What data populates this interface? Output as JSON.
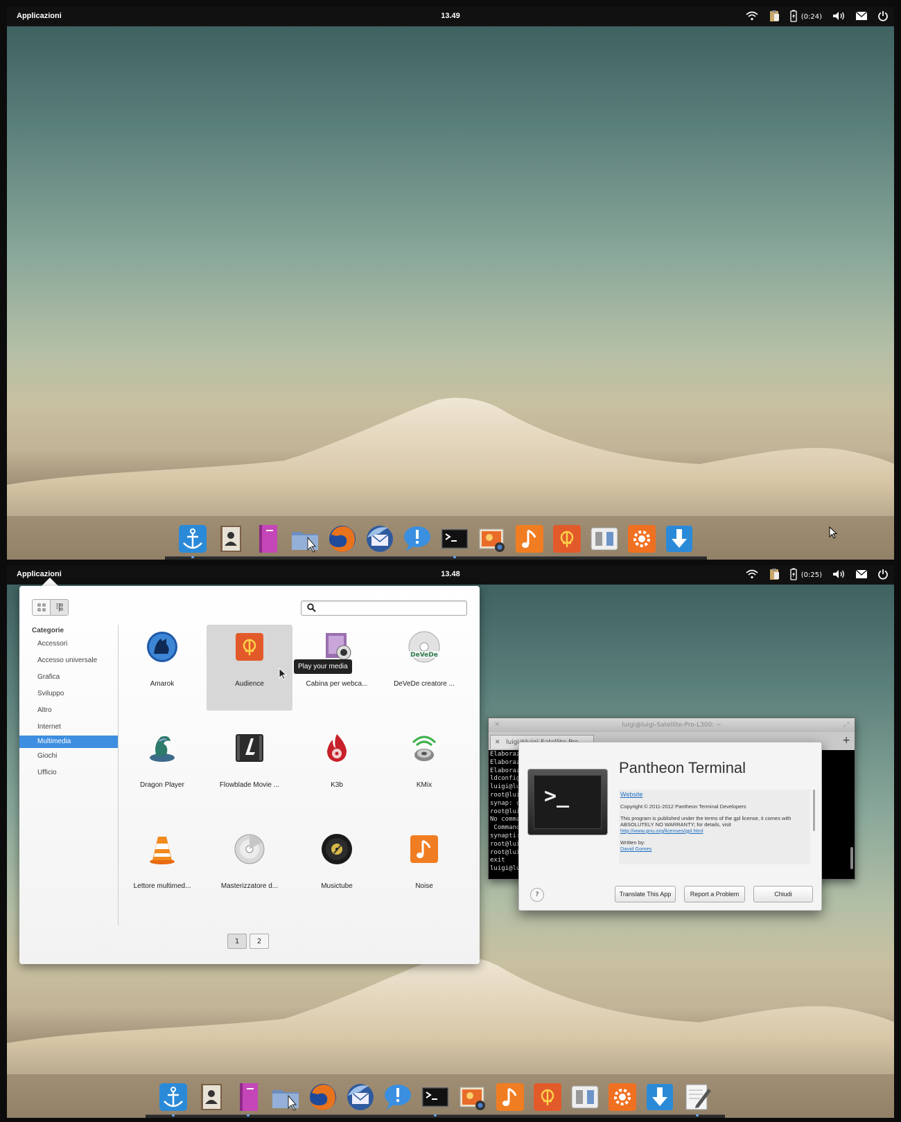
{
  "screen1": {
    "panel": {
      "apps_label": "Applicazioni",
      "clock": "13.49",
      "battery_time": "(0:24)"
    }
  },
  "screen2": {
    "panel": {
      "apps_label": "Applicazioni",
      "clock": "13.48",
      "battery_time": "(0:25)"
    },
    "launcher": {
      "categories_header": "Categorie",
      "categories": [
        "Accessori",
        "Accesso universale",
        "Grafica",
        "Sviluppo",
        "Altro",
        "Internet",
        "Multimedia",
        "Giochi",
        "Ufficio"
      ],
      "selected_category": "Multimedia",
      "apps": [
        "Amarok",
        "Audience",
        "Cabina per webca...",
        "DeVeDe creatore ...",
        "Dragon Player",
        "Flowblade Movie ...",
        "K3b",
        "KMix",
        "Lettore multimed...",
        "Masterizzatore d...",
        "Musictube",
        "Noise"
      ],
      "tooltip": "Play your media",
      "pages": [
        "1",
        "2"
      ]
    },
    "terminal": {
      "title": "luigi@luigi-Satellite-Pro-L300: ~",
      "tab_label": "luigi@luigi-Satellite-Pro-L300: ~",
      "lines": [
        "Elaborazi",
        "Elaborazi",
        "Elaborazi",
        "ldconfig",
        "luigi@lui",
        "root@luigi",
        "synap: co",
        "root@luigi",
        "No comman",
        " Command",
        "synapti:",
        "root@luigi",
        "root@luigi",
        "exit",
        "luigi@lui"
      ]
    },
    "about": {
      "title": "Pantheon Terminal",
      "website": "Website",
      "copyright": "Copyright © 2011-2012 Pantheon Terminal Developers",
      "license_text": "This program is published under the terms of the gpl license, it comes with ABSOLUTELY NO WARRANTY; for details, visit",
      "license_link": "http://www.gnu.org/licenses/gpl.html",
      "written_by": "Written by:",
      "author": "David Gomes",
      "help": "?",
      "translate_button": "Translate This App",
      "report_button": "Report a Problem",
      "close_button": "Chiudi"
    }
  },
  "dock1_icons": [
    "anchor-icon",
    "contacts-icon",
    "notebook-icon",
    "file-manager-icon",
    "firefox-icon",
    "thunderbird-icon",
    "chat-icon",
    "terminal-icon",
    "photos-icon",
    "music-icon",
    "audience-icon",
    "switchboard-icon",
    "settings-icon",
    "download-icon"
  ],
  "dock2_icons": [
    "anchor-icon",
    "contacts-icon",
    "notebook-icon",
    "file-manager-icon",
    "firefox-icon",
    "thunderbird-icon",
    "chat-icon",
    "terminal-icon",
    "photos-icon",
    "music-icon",
    "audience-icon",
    "switchboard-icon",
    "settings-icon",
    "download-icon",
    "text-editor-icon"
  ]
}
